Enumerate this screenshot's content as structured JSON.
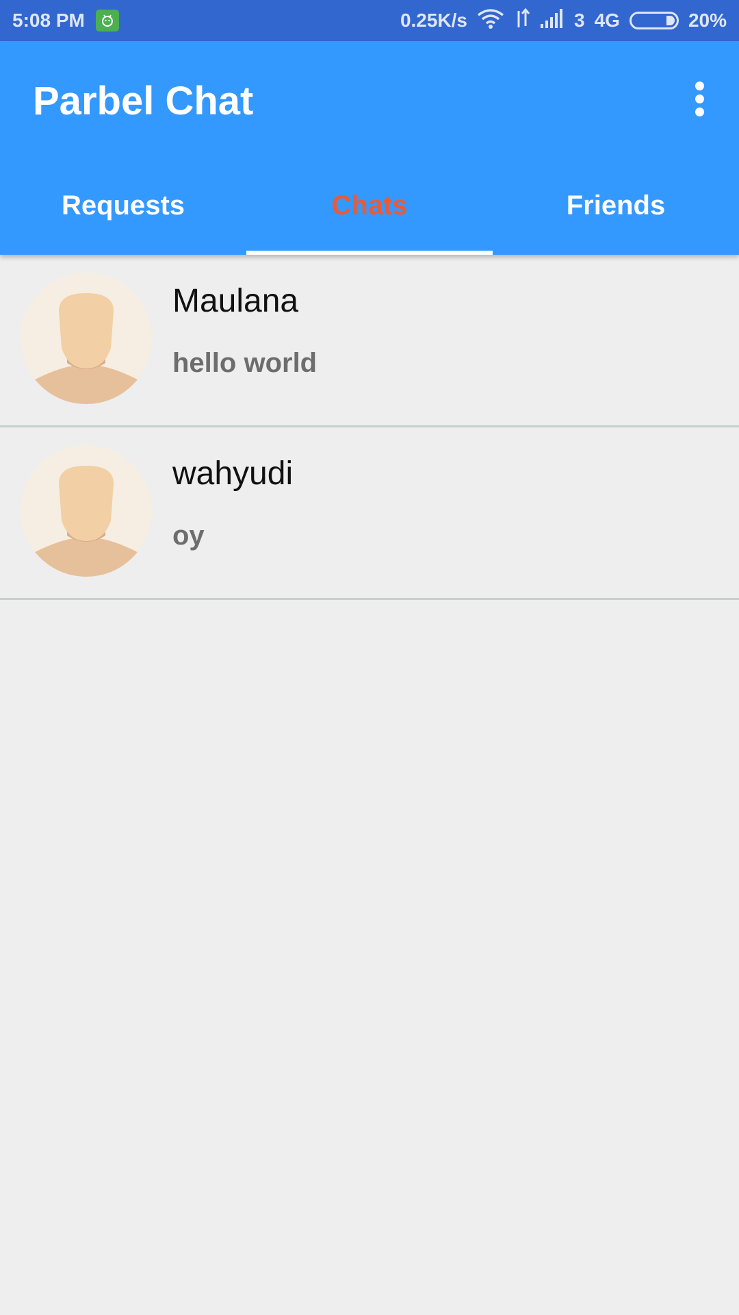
{
  "status_bar": {
    "time": "5:08 PM",
    "speed": "0.25K/s",
    "sim": "3",
    "network": "4G",
    "battery": "20%"
  },
  "app_bar": {
    "title": "Parbel Chat"
  },
  "tabs": [
    {
      "label": "Requests"
    },
    {
      "label": "Chats"
    },
    {
      "label": "Friends"
    }
  ],
  "chats": [
    {
      "name": "Maulana",
      "message": "hello world"
    },
    {
      "name": "wahyudi",
      "message": "oy"
    }
  ],
  "colors": {
    "status_bar": "#3267cf",
    "app_bar": "#3399ff",
    "active_tab": "#ea5a37",
    "background": "#eeeeee"
  }
}
